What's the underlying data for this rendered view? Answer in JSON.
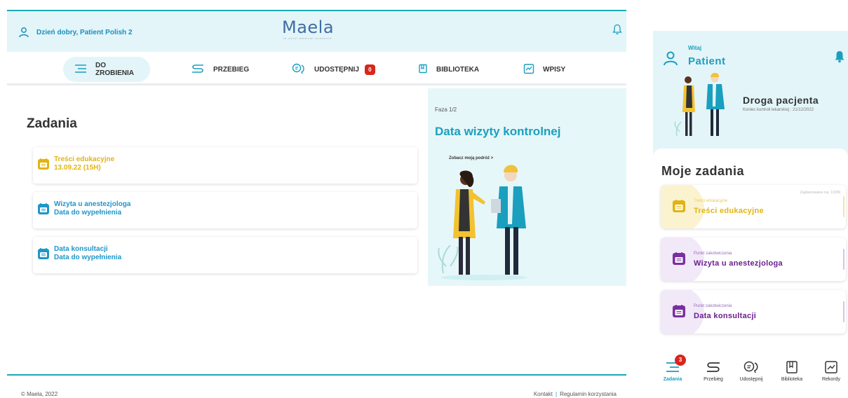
{
  "colors": {
    "accent": "#1a9fbf",
    "yellow": "#e2b413",
    "blue": "#1f96c8",
    "purple": "#7a2fa0",
    "badge": "#d9261c",
    "header_bg": "#e3f5f8"
  },
  "desktop": {
    "header": {
      "greeting": "Dzień dobry, Patient Polish 2",
      "logo": "Maela",
      "logo_tagline": "le suivi médical connecté"
    },
    "nav": [
      {
        "label": "DO ZROBIENIA",
        "icon": "list-icon",
        "active": true
      },
      {
        "label": "PRZEBIEG",
        "icon": "route-icon"
      },
      {
        "label": "UDOSTĘPNIJ",
        "icon": "share-icon",
        "badge": "0"
      },
      {
        "label": "BIBLIOTEKA",
        "icon": "book-icon"
      },
      {
        "label": "WPISY",
        "icon": "chart-icon"
      }
    ],
    "tasks_title": "Zadania",
    "tasks": [
      {
        "title": "Treści edukacyjne",
        "subtitle": "13.09.22 (15H)",
        "color": "yellow"
      },
      {
        "title": "Wizyta u anestezjologa",
        "subtitle": "Data do wypełnienia",
        "color": "blue"
      },
      {
        "title": "Data konsultacji",
        "subtitle": "Data do wypełnienia",
        "color": "blue"
      }
    ],
    "side": {
      "phase": "Faza 1/2",
      "title": "Data wizyty kontrolnej",
      "link": "Zobacz moją podróż >"
    },
    "footer": {
      "copyright": "© Maela, 2022",
      "contact": "Kontakt",
      "terms": "Regulamin korzystania"
    }
  },
  "mobile": {
    "greeting_small": "Witaj",
    "name": "Patient",
    "card_title": "Droga pacjenta",
    "card_sub": "Koniec kontroli lekarskiej : 21/12/2022",
    "tasks_title": "Moje zadania",
    "tasks": [
      {
        "small": "Treści edukacyjne",
        "big": "Treści edukacyjne",
        "planned": "Zaplanowane na: 13/09",
        "color": "yellow"
      },
      {
        "small": "Punkt zakotwiczenia",
        "big": "Wizyta u anestezjologa",
        "color": "purple"
      },
      {
        "small": "Punkt zakotwiczenia",
        "big": "Data konsultacji",
        "color": "purple"
      }
    ],
    "nav": [
      {
        "label": "Zadania",
        "icon": "list-icon",
        "active": true,
        "badge": "3"
      },
      {
        "label": "Przebieg",
        "icon": "route-icon"
      },
      {
        "label": "Udostępnij",
        "icon": "share-icon"
      },
      {
        "label": "Biblioteka",
        "icon": "book-icon"
      },
      {
        "label": "Rekordy",
        "icon": "chart-icon"
      }
    ]
  }
}
